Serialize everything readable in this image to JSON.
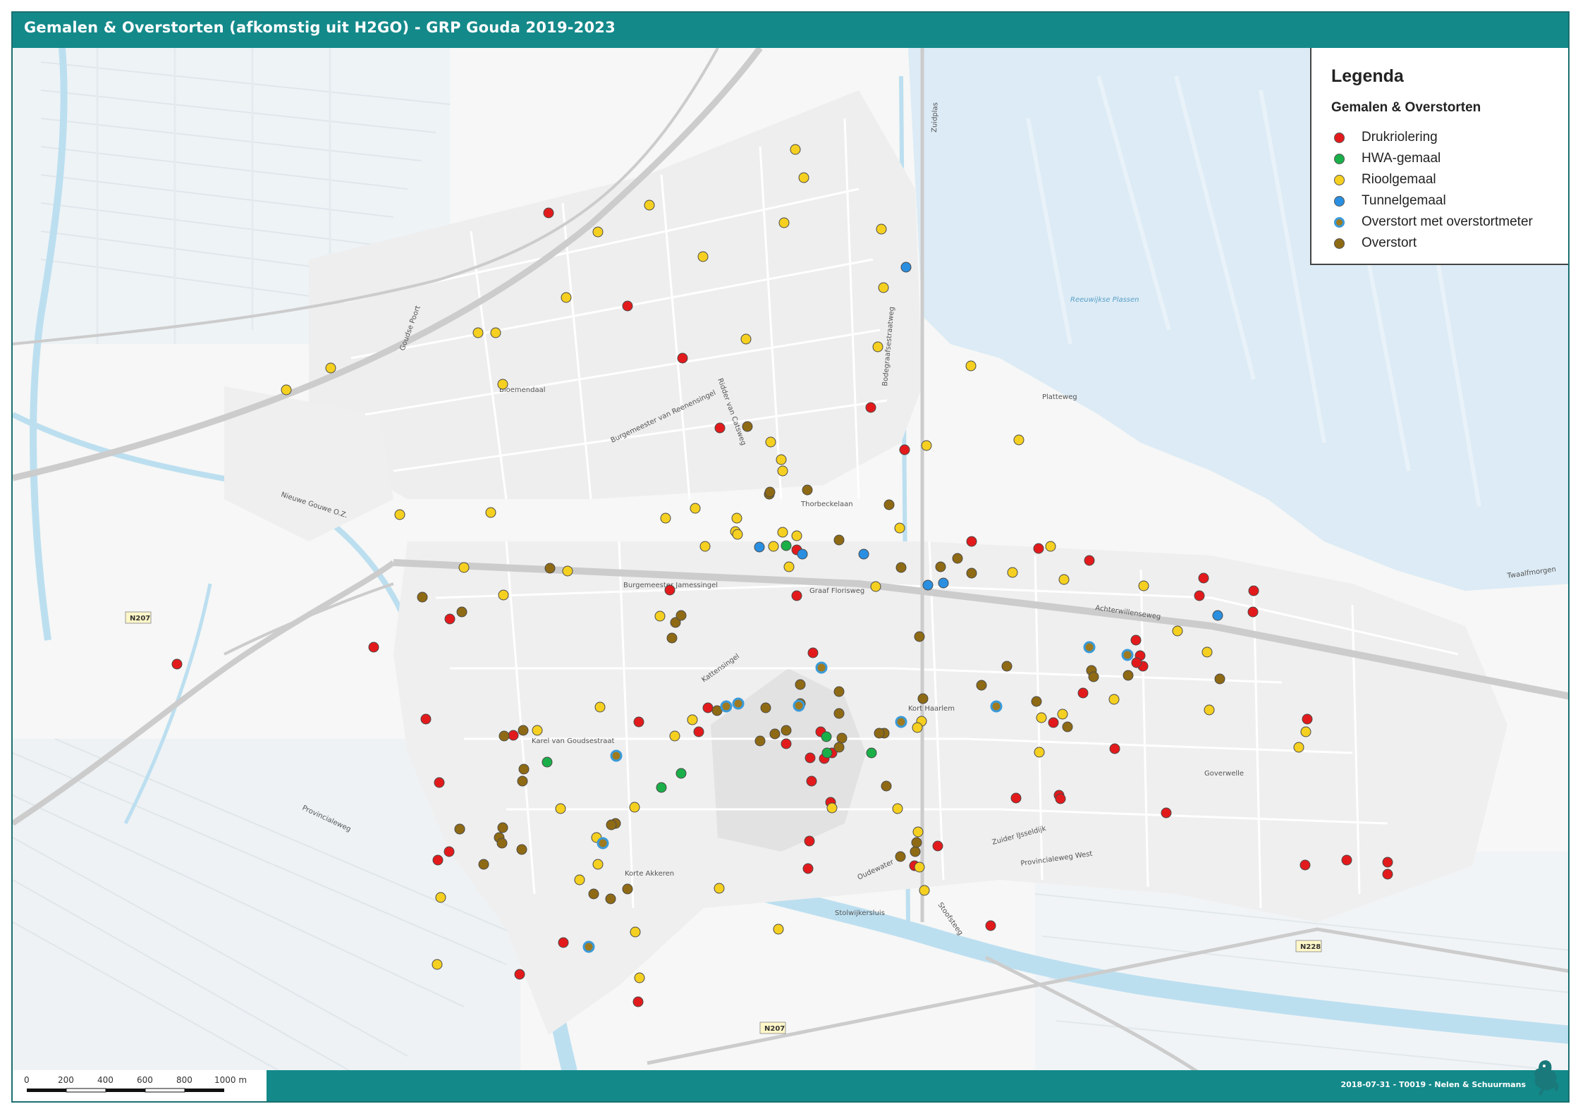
{
  "title": "Gemalen & Overstorten (afkomstig uit H2GO) - GRP Gouda 2019-2023",
  "legend": {
    "title": "Legenda",
    "subtitle": "Gemalen & Overstorten",
    "items": [
      {
        "key": "druk",
        "label": "Drukriolering",
        "fill": "#e31a1c",
        "ring": false
      },
      {
        "key": "hwa",
        "label": "HWA-gemaal",
        "fill": "#1aaf48",
        "ring": false
      },
      {
        "key": "riool",
        "label": "Rioolgemaal",
        "fill": "#f5d020",
        "ring": false
      },
      {
        "key": "tunnel",
        "label": "Tunnelgemaal",
        "fill": "#2a8fe0",
        "ring": false
      },
      {
        "key": "meter",
        "label": "Overstort met overstortmeter",
        "fill": "#a07a1e",
        "ring": true
      },
      {
        "key": "overstort",
        "label": "Overstort",
        "fill": "#8f6a14",
        "ring": false
      }
    ]
  },
  "footer": {
    "credit": "2018-07-31 - T0019 - Nelen & Schuurmans"
  },
  "scale": {
    "ticks": [
      "0",
      "200",
      "400",
      "600",
      "800",
      "1000 m"
    ]
  },
  "road_labels": [
    "N207",
    "N207",
    "N228"
  ],
  "street_labels": [
    "Goudse Poort",
    "Bloemendaal",
    "Burgemeester van Reenensingel",
    "Ridder van Catsweg",
    "Thorbeckelaan",
    "Burgemeester Jamessingel",
    "Graaf Florisweg",
    "Nieuwe Gouwe O.Z.",
    "Kattensingel",
    "Karel van Goudsestraat",
    "Korte Akkeren",
    "Kort Haarlem",
    "Goverwelle",
    "Zuider IJsseldijk",
    "Provincialeweg West",
    "Provincialeweg",
    "Platteweg",
    "Oudewater",
    "Stolwijkersluis",
    "Stoofsteeg",
    "Zuidplas",
    "Achterwillenseweg",
    "Bodegraafsestraatweg",
    "Reeuwijkse Plassen",
    "Twaalfmorgen"
  ],
  "points": {
    "druk": [
      [
        778,
        302
      ],
      [
        890,
        434
      ],
      [
        968,
        508
      ],
      [
        1021,
        607
      ],
      [
        1235,
        578
      ],
      [
        1283,
        638
      ],
      [
        1378,
        768
      ],
      [
        1473,
        778
      ],
      [
        1545,
        795
      ],
      [
        1707,
        820
      ],
      [
        1778,
        838
      ],
      [
        1130,
        845
      ],
      [
        1611,
        908
      ],
      [
        1617,
        930
      ],
      [
        1621,
        945
      ],
      [
        1536,
        983
      ],
      [
        1494,
        1025
      ],
      [
        1581,
        1062
      ],
      [
        1502,
        1128
      ],
      [
        1441,
        1132
      ],
      [
        1854,
        1020
      ],
      [
        1297,
        1228
      ],
      [
        1405,
        1313
      ],
      [
        1146,
        1232
      ],
      [
        1164,
        1038
      ],
      [
        1151,
        1108
      ],
      [
        1330,
        1200
      ],
      [
        1851,
        1227
      ],
      [
        1910,
        1220
      ],
      [
        1968,
        1223
      ],
      [
        1968,
        1240
      ],
      [
        1654,
        1153
      ],
      [
        1178,
        1138
      ],
      [
        1149,
        1075
      ],
      [
        1153,
        926
      ],
      [
        1130,
        780
      ],
      [
        1004,
        1004
      ],
      [
        906,
        1024
      ],
      [
        991,
        1038
      ],
      [
        728,
        1043
      ],
      [
        623,
        1110
      ],
      [
        652,
        1176
      ],
      [
        637,
        1208
      ],
      [
        621,
        1220
      ],
      [
        530,
        918
      ],
      [
        604,
        1020
      ],
      [
        799,
        1337
      ],
      [
        737,
        1382
      ],
      [
        905,
        1421
      ],
      [
        638,
        878
      ],
      [
        251,
        942
      ],
      [
        1148,
        1193
      ],
      [
        1115,
        1055
      ],
      [
        1169,
        1076
      ],
      [
        1180,
        1068
      ],
      [
        1777,
        868
      ],
      [
        1701,
        845
      ],
      [
        950,
        837
      ],
      [
        1612,
        940
      ],
      [
        1504,
        1133
      ]
    ],
    "hwa": [
      [
        1115,
        774
      ],
      [
        776,
        1081
      ],
      [
        938,
        1117
      ],
      [
        966,
        1097
      ],
      [
        1173,
        1068
      ],
      [
        1236,
        1068
      ],
      [
        1172,
        1045
      ]
    ],
    "riool": [
      [
        1128,
        212
      ],
      [
        1140,
        252
      ],
      [
        921,
        291
      ],
      [
        848,
        329
      ],
      [
        1112,
        316
      ],
      [
        1250,
        325
      ],
      [
        997,
        364
      ],
      [
        803,
        422
      ],
      [
        1253,
        408
      ],
      [
        678,
        472
      ],
      [
        703,
        472
      ],
      [
        1245,
        492
      ],
      [
        1058,
        481
      ],
      [
        1377,
        519
      ],
      [
        406,
        553
      ],
      [
        469,
        522
      ],
      [
        713,
        545
      ],
      [
        1314,
        632
      ],
      [
        1445,
        624
      ],
      [
        1093,
        627
      ],
      [
        1108,
        652
      ],
      [
        1110,
        668
      ],
      [
        986,
        721
      ],
      [
        696,
        727
      ],
      [
        567,
        730
      ],
      [
        944,
        735
      ],
      [
        1045,
        735
      ],
      [
        1043,
        754
      ],
      [
        1110,
        755
      ],
      [
        1276,
        749
      ],
      [
        1000,
        775
      ],
      [
        1097,
        775
      ],
      [
        1119,
        804
      ],
      [
        1436,
        812
      ],
      [
        1509,
        822
      ],
      [
        1622,
        831
      ],
      [
        1242,
        832
      ],
      [
        1490,
        775
      ],
      [
        1046,
        758
      ],
      [
        658,
        805
      ],
      [
        805,
        810
      ],
      [
        714,
        844
      ],
      [
        936,
        874
      ],
      [
        1670,
        895
      ],
      [
        1712,
        925
      ],
      [
        1852,
        1038
      ],
      [
        1580,
        992
      ],
      [
        1715,
        1007
      ],
      [
        1842,
        1060
      ],
      [
        1307,
        1023
      ],
      [
        1301,
        1032
      ],
      [
        1477,
        1018
      ],
      [
        1507,
        1013
      ],
      [
        1474,
        1067
      ],
      [
        982,
        1021
      ],
      [
        957,
        1044
      ],
      [
        762,
        1036
      ],
      [
        851,
        1003
      ],
      [
        900,
        1145
      ],
      [
        795,
        1147
      ],
      [
        846,
        1188
      ],
      [
        822,
        1248
      ],
      [
        848,
        1226
      ],
      [
        1180,
        1146
      ],
      [
        1273,
        1147
      ],
      [
        1302,
        1180
      ],
      [
        1311,
        1263
      ],
      [
        1020,
        1260
      ],
      [
        1104,
        1318
      ],
      [
        901,
        1322
      ],
      [
        907,
        1387
      ],
      [
        625,
        1273
      ],
      [
        620,
        1368
      ],
      [
        1304,
        1230
      ],
      [
        1130,
        760
      ]
    ],
    "tunnel": [
      [
        1285,
        379
      ],
      [
        1077,
        776
      ],
      [
        1138,
        786
      ],
      [
        1225,
        786
      ],
      [
        1316,
        830
      ],
      [
        1338,
        827
      ],
      [
        1727,
        873
      ]
    ],
    "meter": [
      [
        1165,
        947
      ],
      [
        1545,
        918
      ],
      [
        1599,
        929
      ],
      [
        1030,
        1002
      ],
      [
        1047,
        998
      ],
      [
        1133,
        1001
      ],
      [
        1413,
        1002
      ],
      [
        1278,
        1024
      ],
      [
        874,
        1072
      ],
      [
        855,
        1196
      ],
      [
        835,
        1343
      ]
    ],
    "overstort": [
      [
        1060,
        605
      ],
      [
        1091,
        701
      ],
      [
        1145,
        695
      ],
      [
        1092,
        698
      ],
      [
        1261,
        716
      ],
      [
        1190,
        766
      ],
      [
        1278,
        805
      ],
      [
        1358,
        792
      ],
      [
        1334,
        804
      ],
      [
        1378,
        813
      ],
      [
        599,
        847
      ],
      [
        655,
        868
      ],
      [
        780,
        806
      ],
      [
        958,
        883
      ],
      [
        966,
        873
      ],
      [
        953,
        905
      ],
      [
        1304,
        903
      ],
      [
        1428,
        945
      ],
      [
        1392,
        972
      ],
      [
        1548,
        951
      ],
      [
        1551,
        960
      ],
      [
        1600,
        958
      ],
      [
        1730,
        963
      ],
      [
        1135,
        971
      ],
      [
        1190,
        981
      ],
      [
        1190,
        1012
      ],
      [
        1309,
        991
      ],
      [
        1470,
        995
      ],
      [
        1514,
        1031
      ],
      [
        1254,
        1040
      ],
      [
        1247,
        1040
      ],
      [
        1257,
        1115
      ],
      [
        1133,
        1000
      ],
      [
        1135,
        998
      ],
      [
        1194,
        1047
      ],
      [
        1086,
        1004
      ],
      [
        1017,
        1008
      ],
      [
        1099,
        1041
      ],
      [
        1115,
        1036
      ],
      [
        1190,
        1060
      ],
      [
        1078,
        1051
      ],
      [
        742,
        1036
      ],
      [
        715,
        1044
      ],
      [
        743,
        1091
      ],
      [
        741,
        1108
      ],
      [
        652,
        1176
      ],
      [
        713,
        1174
      ],
      [
        708,
        1188
      ],
      [
        712,
        1196
      ],
      [
        686,
        1226
      ],
      [
        740,
        1205
      ],
      [
        873,
        1168
      ],
      [
        867,
        1170
      ],
      [
        1277,
        1215
      ],
      [
        1298,
        1208
      ],
      [
        842,
        1268
      ],
      [
        866,
        1275
      ],
      [
        890,
        1261
      ],
      [
        1300,
        1195
      ]
    ]
  }
}
